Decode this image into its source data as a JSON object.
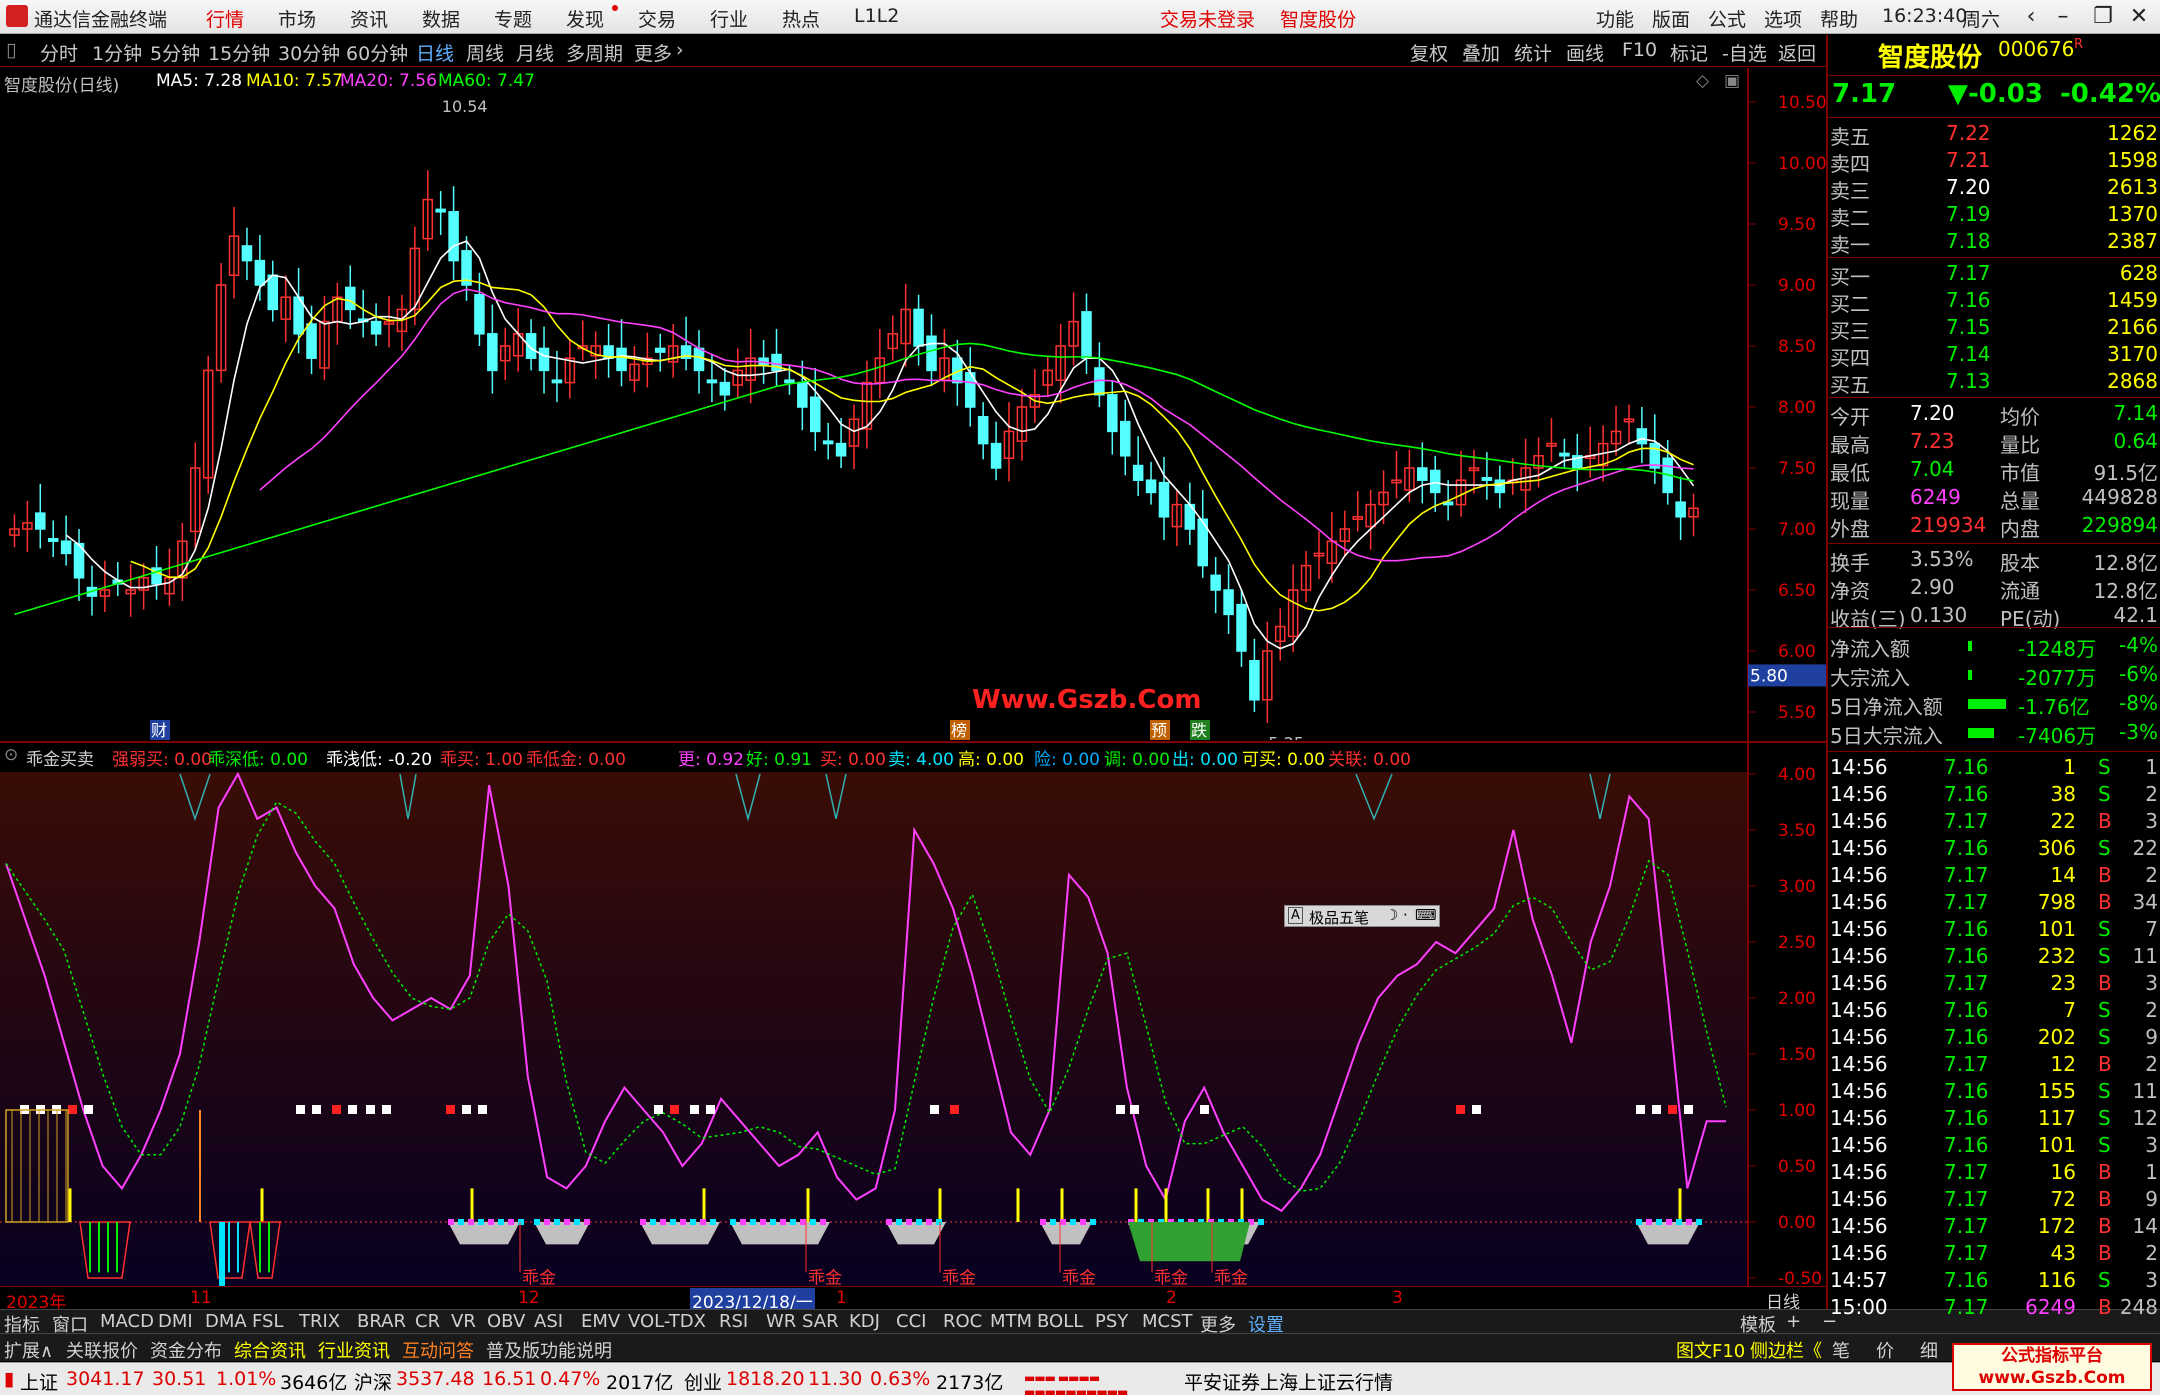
{
  "app": {
    "title": "通达信金融终端",
    "menu": [
      "行情",
      "市场",
      "资讯",
      "数据",
      "专题",
      "发现",
      "交易",
      "行业",
      "热点",
      "L1L2"
    ],
    "menu_active": "行情",
    "trade_status": "交易未登录",
    "stock_link": "智度股份",
    "right_menu": [
      "功能",
      "版面",
      "公式",
      "选项",
      "帮助"
    ],
    "clock": "16:23:40",
    "weekday": "周六"
  },
  "timeframes": [
    "分时",
    "1分钟",
    "5分钟",
    "15分钟",
    "30分钟",
    "60分钟",
    "日线",
    "周线",
    "月线",
    "多周期",
    "更多"
  ],
  "timeframe_active": "日线",
  "right_tools": [
    "复权",
    "叠加",
    "统计",
    "画线",
    "F10",
    "标记",
    "-自选",
    "返回"
  ],
  "chart_title": "智度股份(日线)",
  "ma_legend": [
    {
      "label": "MA5: 7.28",
      "color": "#ffffff"
    },
    {
      "label": "MA10: 7.57",
      "color": "#ffff00"
    },
    {
      "label": "MA20: 7.56",
      "color": "#ff40ff"
    },
    {
      "label": "MA60: 7.47",
      "color": "#00ff00"
    }
  ],
  "price_axis": [
    "10.50",
    "10.00",
    "9.50",
    "9.00",
    "8.50",
    "8.00",
    "7.50",
    "7.00",
    "6.50",
    "6.00",
    "5.50"
  ],
  "price_badge": "5.80",
  "high_label": "10.54",
  "low_label": "5.25",
  "site_watermark": "Www.Gszb.Com",
  "event_markers": [
    "财",
    "榜",
    "预",
    "跌"
  ],
  "indicator_name": "乖金买卖",
  "indicator_legend": [
    {
      "label": "强弱买: 0.00",
      "color": "#ff3030"
    },
    {
      "label": "乖深低: 0.00",
      "color": "#00ee00"
    },
    {
      "label": "乖浅低: -0.20",
      "color": "#ffffff"
    },
    {
      "label": "乖买: 1.00",
      "color": "#ff3030"
    },
    {
      "label": "乖低金: 0.00",
      "color": "#ff3030"
    },
    {
      "label": "更: 0.92",
      "color": "#ff40ff"
    },
    {
      "label": "好: 0.91",
      "color": "#00ee00"
    },
    {
      "label": "买: 0.00",
      "color": "#ff3030"
    },
    {
      "label": "卖: 4.00",
      "color": "#00e5ff"
    },
    {
      "label": "高: 0.00",
      "color": "#ffff00"
    },
    {
      "label": "险: 0.00",
      "color": "#00aaff"
    },
    {
      "label": "调: 0.00",
      "color": "#00ee00"
    },
    {
      "label": "出: 0.00",
      "color": "#00e5ff"
    },
    {
      "label": "可买: 0.00",
      "color": "#ffff00"
    },
    {
      "label": "关联: 0.00",
      "color": "#ff3030"
    }
  ],
  "indicator_axis": [
    "4.00",
    "3.50",
    "3.00",
    "2.50",
    "2.00",
    "1.50",
    "1.00",
    "0.50",
    "0.00",
    "-0.50"
  ],
  "indicator_tag": "乖金",
  "floating_tool": "极品五笔",
  "date_axis": [
    "2023年",
    "11",
    "12",
    "2023/12/18/一",
    "1",
    "2",
    "3"
  ],
  "period_label": "日线",
  "tabs_row1": [
    "指标",
    "窗口",
    "MACD",
    "DMI",
    "DMA",
    "FSL",
    "TRIX",
    "BRAR",
    "CR",
    "VR",
    "OBV",
    "ASI",
    "EMV",
    "VOL-TDX",
    "RSI",
    "WR",
    "SAR",
    "KDJ",
    "CCI",
    "ROC",
    "MTM",
    "BOLL",
    "PSY",
    "MCST",
    "更多",
    "设置"
  ],
  "tabs_row1_right": [
    "模板",
    "+",
    "−"
  ],
  "tabs_row2": [
    "扩展∧",
    "关联报价",
    "资金分布",
    "综合资讯",
    "行业资讯",
    "互动问答",
    "普及版功能说明"
  ],
  "tabs_row2_right": [
    "图文F10",
    "侧边栏《",
    "笔",
    "价",
    "细"
  ],
  "status": {
    "sh_label": "上证",
    "sh_val": "3041.17",
    "sh_chg": "30.51",
    "sh_pct": "1.01%",
    "sh_amt": "3646亿",
    "sz_label": "沪深",
    "sz_val": "3537.48",
    "sz_chg": "16.51",
    "sz_pct": "0.47%",
    "sz_amt": "2017亿",
    "cy_label": "创业",
    "cy_val": "1818.20",
    "cy_chg": "11.30",
    "cy_pct": "0.63%",
    "cy_amt": "2173亿",
    "broker": "平安证券上海上证云行情"
  },
  "quote": {
    "name": "智度股份",
    "code": "000676",
    "flag": "R",
    "price": "7.17",
    "change": "▼-0.03",
    "pct": "-0.42%"
  },
  "asks": [
    {
      "label": "卖五",
      "price": "7.22",
      "vol": "1262"
    },
    {
      "label": "卖四",
      "price": "7.21",
      "vol": "1598"
    },
    {
      "label": "卖三",
      "price": "7.20",
      "vol": "2613"
    },
    {
      "label": "卖二",
      "price": "7.19",
      "vol": "1370"
    },
    {
      "label": "卖一",
      "price": "7.18",
      "vol": "2387"
    }
  ],
  "bids": [
    {
      "label": "买一",
      "price": "7.17",
      "vol": "628"
    },
    {
      "label": "买二",
      "price": "7.16",
      "vol": "1459"
    },
    {
      "label": "买三",
      "price": "7.15",
      "vol": "2166"
    },
    {
      "label": "买四",
      "price": "7.14",
      "vol": "3170"
    },
    {
      "label": "买五",
      "price": "7.13",
      "vol": "2868"
    }
  ],
  "stats": [
    {
      "l1": "今开",
      "v1": "7.20",
      "c1": "#ffffff",
      "l2": "均价",
      "v2": "7.14",
      "c2": "#00ee00"
    },
    {
      "l1": "最高",
      "v1": "7.23",
      "c1": "#ff3030",
      "l2": "量比",
      "v2": "0.64",
      "c2": "#00ee00"
    },
    {
      "l1": "最低",
      "v1": "7.04",
      "c1": "#00ee00",
      "l2": "市值",
      "v2": "91.5亿",
      "c2": "#c0c0c0"
    },
    {
      "l1": "现量",
      "v1": "6249",
      "c1": "#ff40ff",
      "l2": "总量",
      "v2": "449828",
      "c2": "#c0c0c0"
    },
    {
      "l1": "外盘",
      "v1": "219934",
      "c1": "#ff3030",
      "l2": "内盘",
      "v2": "229894",
      "c2": "#00ee00"
    },
    {
      "l1": "换手",
      "v1": "3.53%",
      "c1": "#c0c0c0",
      "l2": "股本",
      "v2": "12.8亿",
      "c2": "#c0c0c0"
    },
    {
      "l1": "净资",
      "v1": "2.90",
      "c1": "#c0c0c0",
      "l2": "流通",
      "v2": "12.8亿",
      "c2": "#c0c0c0"
    },
    {
      "l1": "收益(三)",
      "v1": "0.130",
      "c1": "#c0c0c0",
      "l2": "PE(动)",
      "v2": "42.1",
      "c2": "#c0c0c0"
    }
  ],
  "flows": [
    {
      "label": "净流入额",
      "val": "-1248万",
      "pct": "-4%"
    },
    {
      "label": "大宗流入",
      "val": "-2077万",
      "pct": "-6%"
    },
    {
      "label": "5日净流入额",
      "val": "-1.76亿",
      "pct": "-8%"
    },
    {
      "label": "5日大宗流入",
      "val": "-7406万",
      "pct": "-3%"
    }
  ],
  "ticks": [
    {
      "t": "14:56",
      "p": "7.16",
      "v": "1",
      "d": "S",
      "n": "1"
    },
    {
      "t": "14:56",
      "p": "7.16",
      "v": "38",
      "d": "S",
      "n": "2"
    },
    {
      "t": "14:56",
      "p": "7.17",
      "v": "22",
      "d": "B",
      "n": "3"
    },
    {
      "t": "14:56",
      "p": "7.16",
      "v": "306",
      "d": "S",
      "n": "22"
    },
    {
      "t": "14:56",
      "p": "7.17",
      "v": "14",
      "d": "B",
      "n": "2"
    },
    {
      "t": "14:56",
      "p": "7.17",
      "v": "798",
      "d": "B",
      "n": "34"
    },
    {
      "t": "14:56",
      "p": "7.16",
      "v": "101",
      "d": "S",
      "n": "7"
    },
    {
      "t": "14:56",
      "p": "7.16",
      "v": "232",
      "d": "S",
      "n": "11"
    },
    {
      "t": "14:56",
      "p": "7.17",
      "v": "23",
      "d": "B",
      "n": "3"
    },
    {
      "t": "14:56",
      "p": "7.16",
      "v": "7",
      "d": "S",
      "n": "2"
    },
    {
      "t": "14:56",
      "p": "7.16",
      "v": "202",
      "d": "S",
      "n": "9"
    },
    {
      "t": "14:56",
      "p": "7.17",
      "v": "12",
      "d": "B",
      "n": "2"
    },
    {
      "t": "14:56",
      "p": "7.16",
      "v": "155",
      "d": "S",
      "n": "11"
    },
    {
      "t": "14:56",
      "p": "7.16",
      "v": "117",
      "d": "S",
      "n": "12"
    },
    {
      "t": "14:56",
      "p": "7.16",
      "v": "101",
      "d": "S",
      "n": "3"
    },
    {
      "t": "14:56",
      "p": "7.17",
      "v": "16",
      "d": "B",
      "n": "1"
    },
    {
      "t": "14:56",
      "p": "7.17",
      "v": "72",
      "d": "B",
      "n": "9"
    },
    {
      "t": "14:56",
      "p": "7.17",
      "v": "172",
      "d": "B",
      "n": "14"
    },
    {
      "t": "14:56",
      "p": "7.17",
      "v": "43",
      "d": "B",
      "n": "2"
    },
    {
      "t": "14:57",
      "p": "7.16",
      "v": "116",
      "d": "S",
      "n": "3"
    },
    {
      "t": "15:00",
      "p": "7.17",
      "v": "6249",
      "d": "B",
      "n": "248"
    }
  ],
  "watermark": {
    "line1": "公式指标平台",
    "line2": "www.Gszb.Com"
  }
}
